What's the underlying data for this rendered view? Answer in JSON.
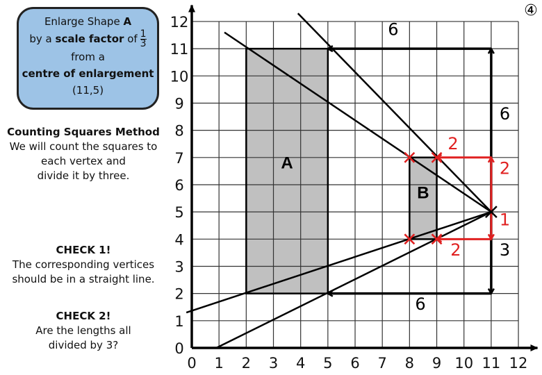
{
  "corner_label": "④",
  "instruction_box": {
    "line1_prefix": "Enlarge Shape ",
    "line1_bold": "A",
    "line2_prefix": "by a ",
    "line2_bold": "scale factor",
    "line2_suffix": " of",
    "fraction_numerator": "1",
    "fraction_denominator": "3",
    "line3": "from a",
    "line4_bold": "centre of enlargement",
    "line5": "(11,5)"
  },
  "method": {
    "heading": "Counting Squares Method",
    "lines": [
      "We will count the squares to",
      "each vertex and",
      "divide it by three."
    ]
  },
  "check1": {
    "heading": "CHECK 1!",
    "lines": [
      "The corresponding vertices",
      "should be in a straight line."
    ]
  },
  "check2": {
    "heading": "CHECK 2!",
    "lines": [
      "Are the lengths all",
      "divided by 3?"
    ]
  },
  "chart_data": {
    "type": "diagram",
    "x_range": [
      0,
      12
    ],
    "y_range": [
      0,
      12
    ],
    "x_ticks": [
      "0",
      "1",
      "2",
      "3",
      "4",
      "5",
      "6",
      "7",
      "8",
      "9",
      "10",
      "11",
      "12"
    ],
    "y_ticks": [
      "0",
      "1",
      "2",
      "3",
      "4",
      "5",
      "6",
      "7",
      "8",
      "9",
      "10",
      "11",
      "12"
    ],
    "grid": true,
    "centre": [
      11,
      5
    ],
    "shapes": [
      {
        "label": "A",
        "vertices": [
          [
            2,
            2
          ],
          [
            5,
            2
          ],
          [
            5,
            11
          ],
          [
            2,
            11
          ]
        ],
        "fill": "#c0c0c0"
      },
      {
        "label": "B",
        "vertices": [
          [
            8,
            4
          ],
          [
            9,
            4
          ],
          [
            9,
            7
          ],
          [
            8,
            7
          ]
        ],
        "fill": "#c0c0c0"
      }
    ],
    "rays": [
      {
        "from": [
          11,
          5
        ],
        "to": [
          3.9,
          12.3
        ]
      },
      {
        "from": [
          11,
          5
        ],
        "to": [
          1.2,
          11.6
        ]
      },
      {
        "from": [
          11,
          5
        ],
        "to": [
          -0.2,
          1.3
        ]
      },
      {
        "from": [
          11,
          5
        ],
        "to": [
          0.9,
          0
        ]
      }
    ],
    "black_arrows": [
      {
        "path": [
          [
            11,
            5
          ],
          [
            11,
            11
          ],
          [
            5,
            11
          ]
        ],
        "labels": [
          {
            "text": "6",
            "at": [
              7.4,
              11.5
            ]
          },
          {
            "text": "6",
            "at": [
              11.5,
              8.4
            ]
          }
        ]
      },
      {
        "path": [
          [
            11,
            5
          ],
          [
            11,
            2
          ],
          [
            5,
            2
          ]
        ],
        "labels": [
          {
            "text": "3",
            "at": [
              11.5,
              3.4
            ]
          },
          {
            "text": "6",
            "at": [
              8.4,
              1.4
            ]
          }
        ]
      }
    ],
    "red_arrows": [
      {
        "path": [
          [
            11,
            5
          ],
          [
            11,
            7
          ],
          [
            9,
            7
          ]
        ],
        "labels": [
          {
            "text": "2",
            "at": [
              11.5,
              6.4
            ]
          },
          {
            "text": "2",
            "at": [
              9.6,
              7.3
            ]
          }
        ]
      },
      {
        "path": [
          [
            11,
            5
          ],
          [
            11,
            4
          ],
          [
            9,
            4
          ]
        ],
        "labels": [
          {
            "text": "1",
            "at": [
              11.5,
              4.5
            ]
          },
          {
            "text": "2",
            "at": [
              9.7,
              3.4
            ]
          }
        ]
      }
    ],
    "red_crosses": [
      [
        8,
        7
      ],
      [
        9,
        7
      ],
      [
        8,
        4
      ],
      [
        9,
        4
      ]
    ],
    "colors": {
      "red": "#e02020",
      "black": "#000000",
      "grid": "#333333"
    }
  }
}
